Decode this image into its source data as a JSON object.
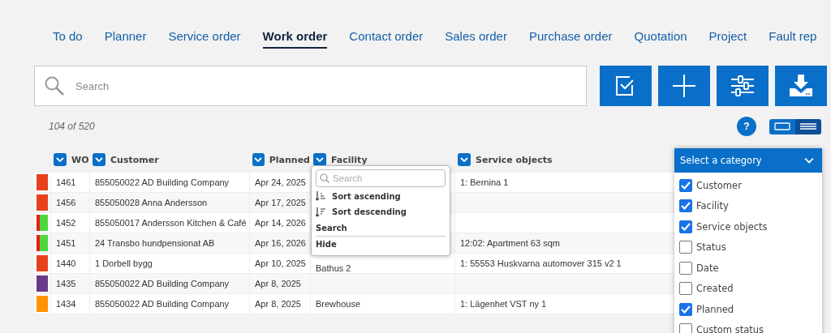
{
  "tabs": [
    {
      "label": "To do",
      "selected": false
    },
    {
      "label": "Planner",
      "selected": false
    },
    {
      "label": "Service order",
      "selected": false
    },
    {
      "label": "Work order",
      "selected": true
    },
    {
      "label": "Contact order",
      "selected": false
    },
    {
      "label": "Sales order",
      "selected": false
    },
    {
      "label": "Purchase order",
      "selected": false
    },
    {
      "label": "Quotation",
      "selected": false
    },
    {
      "label": "Project",
      "selected": false
    },
    {
      "label": "Fault rep",
      "selected": false
    }
  ],
  "search": {
    "placeholder": "Search"
  },
  "toolbar_buttons": [
    {
      "kind": "check"
    },
    {
      "kind": "add"
    },
    {
      "kind": "filter"
    },
    {
      "kind": "download"
    }
  ],
  "count": "104 of 520",
  "help": "?",
  "view_toggle": [
    {
      "kind": "card",
      "selected": false
    },
    {
      "kind": "list",
      "selected": true
    }
  ],
  "table": {
    "columns": [
      {
        "label": "WO"
      },
      {
        "label": "Customer"
      },
      {
        "label": "Planned"
      },
      {
        "label": "Facility"
      },
      {
        "label": "Service objects"
      }
    ],
    "rows": [
      {
        "markers": [
          {
            "color": "#e8401c"
          }
        ],
        "cells": [
          "1461",
          "855050022 AD Building Company",
          "Apr 24, 2025",
          "",
          "1: Bernina 1"
        ]
      },
      {
        "markers": [
          {
            "color": "#e8401c"
          }
        ],
        "cells": [
          "1456",
          "855050028 Anna Andersson",
          "Apr 17, 2025",
          "",
          ""
        ]
      },
      {
        "markers": [
          {
            "color": "#e81c1c"
          },
          {
            "color": "#4cd83c"
          }
        ],
        "cells": [
          "1452",
          "855050017 Andersson Kitchen & Café",
          "Apr 14, 2026",
          "",
          ""
        ]
      },
      {
        "markers": [
          {
            "color": "#e81c1c"
          },
          {
            "color": "#4cd83c"
          }
        ],
        "cells": [
          "1451",
          "24 Transbo hundpensionat AB",
          "Apr 16, 2026",
          "",
          "12:02: Apartment 63 sqm"
        ]
      },
      {
        "markers": [
          {
            "color": "#e8401c"
          }
        ],
        "cells": [
          "1440",
          "1 Dorbell bygg",
          "Apr 10, 2025",
          "Bathus 2",
          "1: 55553 Huskvarna automover 315 v2 1"
        ]
      },
      {
        "markers": [
          {
            "color": "#6a3a8a"
          }
        ],
        "cells": [
          "1435",
          "855050022 AD Building Company",
          "Apr 8, 2025",
          "",
          ""
        ]
      },
      {
        "markers": [
          {
            "color": "#ff9400"
          }
        ],
        "cells": [
          "1434",
          "855050022 AD Building Company",
          "Apr 8, 2025",
          "Brewhouse",
          "1: Lägenhet VST ny 1"
        ]
      }
    ]
  },
  "column_menu": {
    "search_placeholder": "Search",
    "items": [
      {
        "kind": "sort-asc",
        "label": "Sort ascending"
      },
      {
        "kind": "sort-desc",
        "label": "Sort descending"
      },
      {
        "kind": "plain",
        "label": "Search"
      },
      {
        "kind": "divider-plain",
        "label": "Hide"
      }
    ]
  },
  "category_panel": {
    "title": "Select a category",
    "items": [
      {
        "label": "Customer",
        "checked": true
      },
      {
        "label": "Facility",
        "checked": true
      },
      {
        "label": "Service objects",
        "checked": true
      },
      {
        "label": "Status",
        "checked": false
      },
      {
        "label": "Date",
        "checked": false
      },
      {
        "label": "Created",
        "checked": false
      },
      {
        "label": "Planned",
        "checked": true
      },
      {
        "label": "Custom status",
        "checked": false
      }
    ]
  }
}
